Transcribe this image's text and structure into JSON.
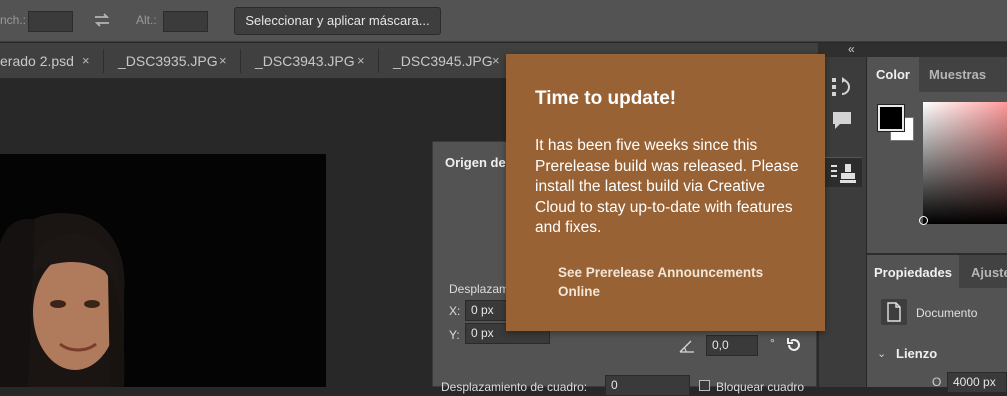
{
  "options_bar": {
    "width_label": "nch.:",
    "swap_icon": "swap-arrows-icon",
    "height_label": "Alt.:",
    "mask_button": "Seleccionar y aplicar máscara..."
  },
  "tabs": [
    {
      "label": "erado 2.psd",
      "close": "×"
    },
    {
      "label": "_DSC3935.JPG",
      "close": "×"
    },
    {
      "label": "_DSC3943.JPG",
      "close": "×"
    },
    {
      "label": "_DSC3945.JPG",
      "close": "×"
    }
  ],
  "dialog": {
    "title": "Origen de",
    "offset_label": "Desplazam",
    "x_label": "X:",
    "x_value": "0 px",
    "y_label": "Y:",
    "y_value": "0 px",
    "angle_value": "0,0",
    "degree_symbol": "°",
    "frame_offset_label": "Desplazamiento de cuadro:",
    "frame_offset_value": "0",
    "lock_frame_label": "Bloquear cuadro"
  },
  "dock": {
    "collapse_glyph": "«",
    "color_tab": "Color",
    "swatches_tab": "Muestras",
    "properties_tab": "Propiedades",
    "adjustments_tab": "Ajuste",
    "document_label": "Documento",
    "canvas_section": "Lienzo",
    "canvas_o_label": "O",
    "canvas_width_value": "4000 px"
  },
  "popup": {
    "title": "Time to update!",
    "body": "It has been five weeks since this Prerelease build was released. Please install the latest build via Creative Cloud to stay up-to-date with features and fixes.",
    "link": "See Prerelease Announcements Online"
  },
  "colors": {
    "popup_bg": "#986234",
    "panel_bg": "#535353",
    "app_bg": "#282828",
    "foreground_swatch": "#000000",
    "background_swatch": "#ffffff"
  }
}
